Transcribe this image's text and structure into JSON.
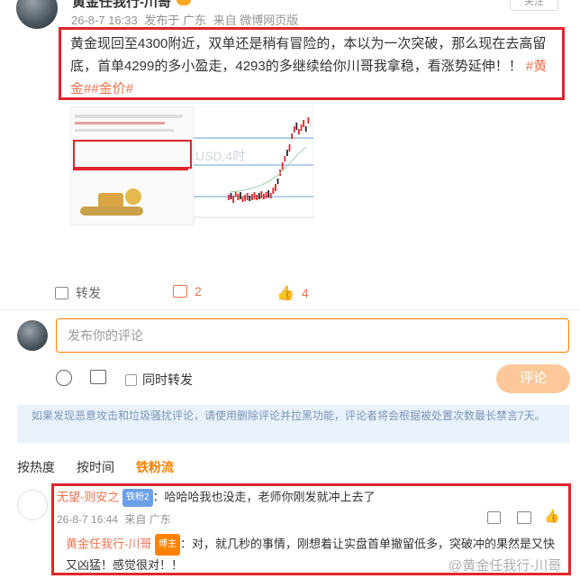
{
  "post": {
    "author": "黄金任我行-川哥",
    "time": "26-8-7 16:33",
    "via_label": "发布于 广东",
    "from_label": "来自 微博网页版",
    "follow_label": "关注",
    "text": "黄金现回至4300附近，双单还是稍有冒险的，本以为一次突破，那么现在去高留底，首单4299的多小盈走，4293的多继续给你川哥我拿稳，看涨势延伸！！",
    "tag1": "#黄金#",
    "tag2": "#金价#",
    "chart_label": "USD,4时"
  },
  "actions": {
    "repost": "转发",
    "comment_count": "2",
    "like_count": "4"
  },
  "composer": {
    "placeholder": "发布你的评论",
    "also_repost": "同时转发",
    "submit": "评论"
  },
  "notice": "如果发现恶意攻击和垃圾骚扰评论，请使用删除评论并拉黑功能，评论者将会根据被处置次数最长禁言7天。",
  "sort_tabs": [
    "按热度",
    "按时间",
    "铁粉流"
  ],
  "comment": {
    "author": "无望-则安之",
    "badge": "铁粉2",
    "text": "：哈哈哈我也没走，老师你刚发就冲上去了",
    "time": "26-8-7 16:44",
    "location": "来自 广东"
  },
  "reply": {
    "author": "黄金任我行-川哥",
    "badge": "博主",
    "text": "：对，就几秒的事情，刚想着让实盘首单撤留低多，突破冲的果然是又快又凶猛！感觉很对！！"
  },
  "watermark": "@黄金任我行-川哥",
  "colors": {
    "red_box": "#e0262b",
    "accent": "#ff8200",
    "link": "#eb7350",
    "notice_bg": "#e9f1fb"
  }
}
